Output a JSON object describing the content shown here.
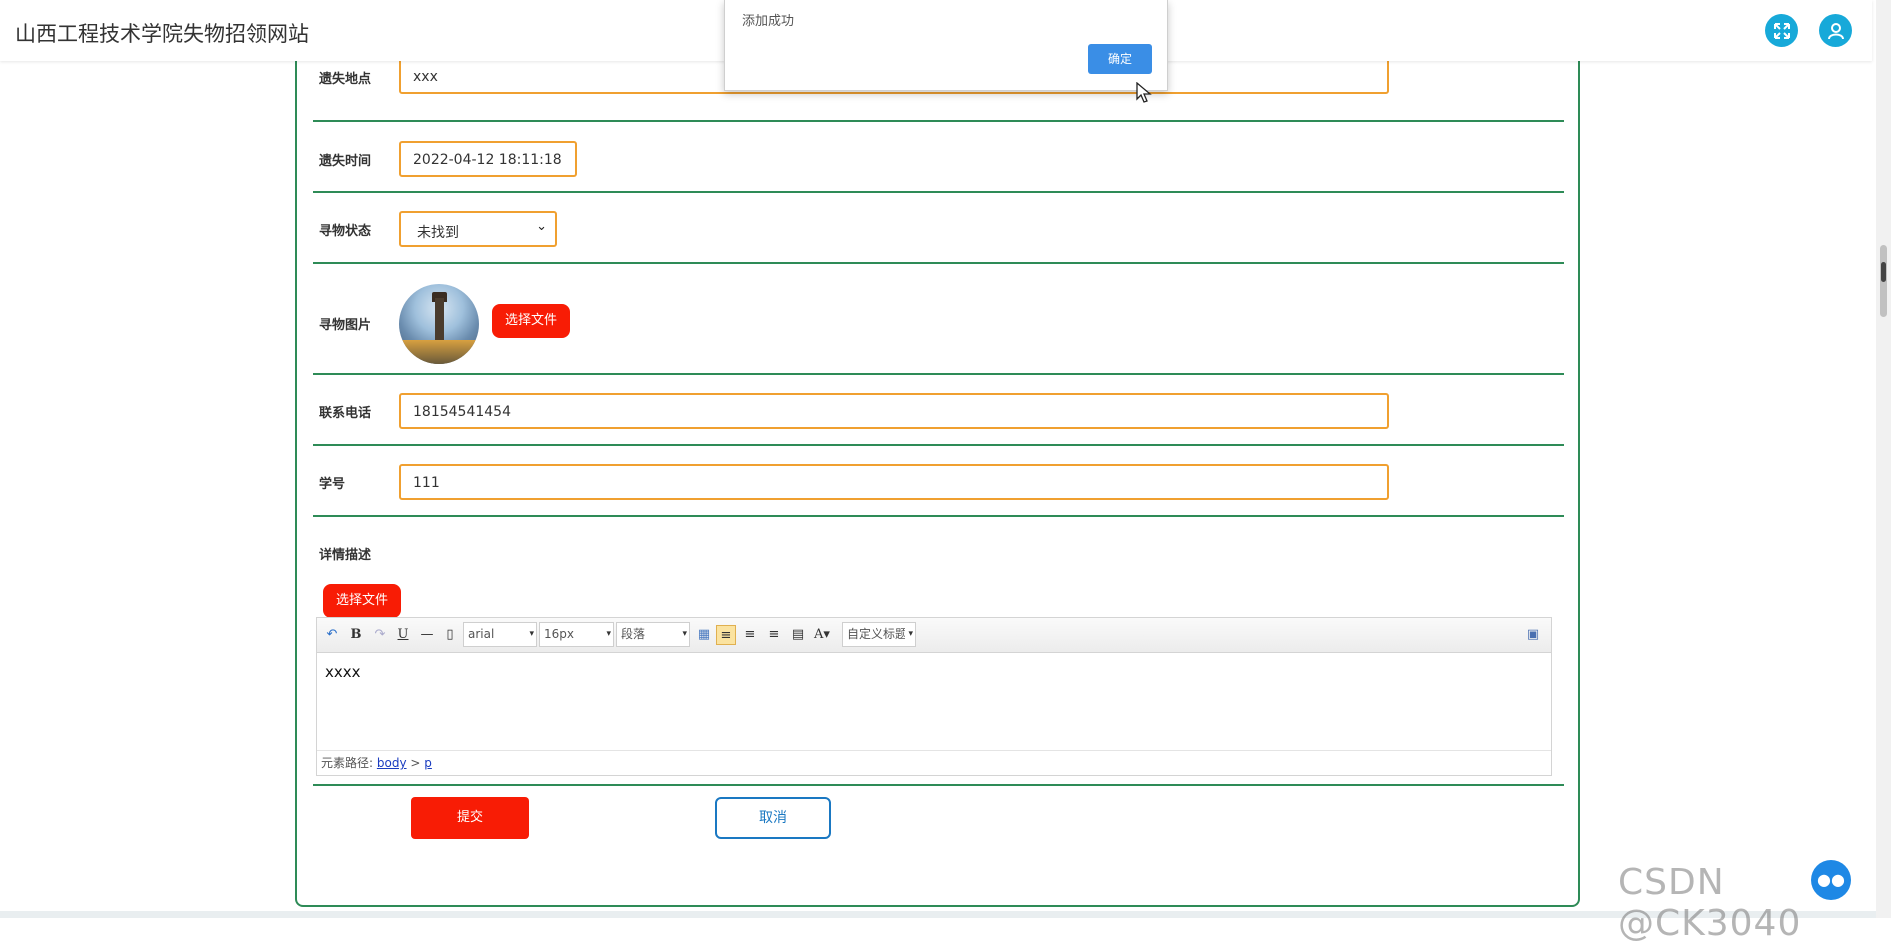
{
  "header": {
    "title": "山西工程技术学院失物招领网站"
  },
  "form": {
    "rows": [
      {
        "label": "遗失地点",
        "value": "xxx"
      },
      {
        "label": "遗失时间",
        "value": "2022-04-12 18:11:18"
      },
      {
        "label": "寻物状态",
        "value": "未找到"
      },
      {
        "label": "寻物图片",
        "button": "选择文件"
      },
      {
        "label": "联系电话",
        "value": "18154541454"
      },
      {
        "label": "学号",
        "value": "111"
      },
      {
        "label": "详情描述"
      }
    ],
    "detail_file_button": "选择文件",
    "submit_label": "提交",
    "cancel_label": "取消"
  },
  "editor": {
    "font_family": "arial",
    "font_size": "16px",
    "paragraph": "段落",
    "custom_title": "自定义标题",
    "content": "xxxx",
    "path_label": "元素路径:",
    "path_body": "body",
    "path_sep": ">",
    "path_p": "p"
  },
  "dialog": {
    "message": "添加成功",
    "ok_label": "确定"
  },
  "watermark": "CSDN @CK3040",
  "colors": {
    "accent_red": "#f81c05",
    "border_green": "#2e8b57",
    "input_orange": "#f0a030",
    "icon_blue": "#17a9d9"
  }
}
